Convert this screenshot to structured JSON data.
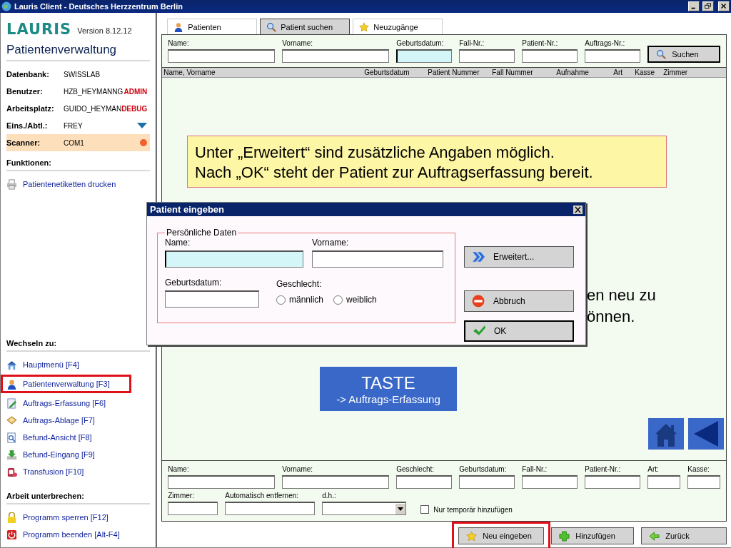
{
  "window": {
    "title": "Lauris Client - Deutsches Herzzentrum Berlin"
  },
  "sidebar": {
    "logo": "LAURIS",
    "version": "Version 8.12.12",
    "title": "Patientenverwaltung",
    "info": [
      {
        "kind": "badge",
        "label": "Datenbank:",
        "value": "SWISSLAB"
      },
      {
        "kind": "badge",
        "label": "Benutzer:",
        "value": "HZB_HEYMANNG",
        "badge": "ADMIN"
      },
      {
        "kind": "badge",
        "label": "Arbeitsplatz:",
        "value": "GUIDO_HEYMAN",
        "badge": "DEBUG"
      },
      {
        "kind": "dropdown",
        "label": "Eins./Abtl.:",
        "value": "FREY"
      },
      {
        "kind": "status",
        "label": "Scanner:",
        "value": "COM1"
      }
    ],
    "functions": {
      "heading": "Funktionen:",
      "items": [
        {
          "label": "Patientenetiketten drucken",
          "highlighted": false
        }
      ]
    },
    "switch": {
      "heading": "Wechseln zu:",
      "items": [
        {
          "label": "Hauptmenü [F4]",
          "highlighted": false
        },
        {
          "label": "Patientenverwaltung [F3]",
          "highlighted": true
        },
        {
          "label": "Auftrags-Erfassung [F6]",
          "highlighted": false
        },
        {
          "label": "Auftrags-Ablage [F7]",
          "highlighted": false
        },
        {
          "label": "Befund-Ansicht [F8]",
          "highlighted": false
        },
        {
          "label": "Befund-Eingang [F9]",
          "highlighted": false
        },
        {
          "label": "Transfusion [F10]",
          "highlighted": false
        }
      ]
    },
    "interrupt": {
      "heading": "Arbeit unterbrechen:",
      "items": [
        {
          "label": "Programm sperren [F12]",
          "highlighted": false
        },
        {
          "label": "Programm beenden [Alt-F4]",
          "highlighted": false
        }
      ]
    }
  },
  "tabs": [
    {
      "label": "Patienten",
      "selected": false
    },
    {
      "label": "Patient suchen",
      "selected": true
    },
    {
      "label": "Neuzugänge",
      "selected": false
    }
  ],
  "search": {
    "fields": [
      {
        "label": "Name:",
        "focused": false
      },
      {
        "label": "Vorname:",
        "focused": false
      },
      {
        "label": "Geburtsdatum:",
        "focused": true
      },
      {
        "label": "Fall-Nr.:",
        "focused": false
      },
      {
        "label": "Patient-Nr.:",
        "focused": false
      },
      {
        "label": "Auftrags-Nr.:",
        "focused": false
      }
    ],
    "button": "Suchen"
  },
  "table": {
    "columns": [
      "Name,  Vorname",
      "Geburtsdatum",
      "Patient Nummer",
      "Fall Nummer",
      "Aufnahme",
      "Art",
      "Kasse",
      "Zimmer"
    ]
  },
  "callout": {
    "lines": [
      "Unter „Erweitert“ sind zusätzliche Angaben möglich.",
      "Nach „OK“ steht der Patient zur Auftragserfassung bereit."
    ]
  },
  "hidden_callout": {
    "lines": [
      "en neu zu",
      "önnen."
    ]
  },
  "key_hint": {
    "title": "TASTE",
    "subtitle": "-> Auftrags-Erfassung"
  },
  "dialog": {
    "title": "Patient eingeben",
    "group": "Persönliche Daten",
    "fields": [
      {
        "label": "Name:",
        "focused": true
      },
      {
        "label": "Vorname:",
        "focused": false
      },
      {
        "label": "Geburtsdatum:",
        "focused": false
      }
    ],
    "gender": {
      "label": "Geschlecht:",
      "options": [
        {
          "label": "männlich",
          "selected": false
        },
        {
          "label": "weiblich",
          "selected": false
        }
      ]
    },
    "buttons": [
      {
        "label": "Erweitert...",
        "default": false
      },
      {
        "label": "Abbruch",
        "default": false
      },
      {
        "label": "OK",
        "default": true
      }
    ]
  },
  "entry": {
    "row1": [
      {
        "label": "Name:"
      },
      {
        "label": "Vorname:"
      },
      {
        "label": "Geschlecht:"
      },
      {
        "label": "Geburtsdatum:"
      },
      {
        "label": "Fall-Nr.:"
      },
      {
        "label": "Patient-Nr.:"
      },
      {
        "label": "Art:"
      },
      {
        "label": "Kasse:"
      }
    ],
    "row2": [
      {
        "label": "Zimmer:",
        "kind": "text"
      },
      {
        "label": "Automatisch entfernen:",
        "kind": "text"
      },
      {
        "label": "d.h.:",
        "kind": "select"
      }
    ],
    "checkbox": {
      "label": "Nur temporär hinzufügen",
      "checked": false
    }
  },
  "footer": [
    {
      "label": "Neu eingeben",
      "highlighted": true
    },
    {
      "label": "Hinzufügen",
      "highlighted": false
    },
    {
      "label": "Zurück",
      "highlighted": false
    }
  ]
}
